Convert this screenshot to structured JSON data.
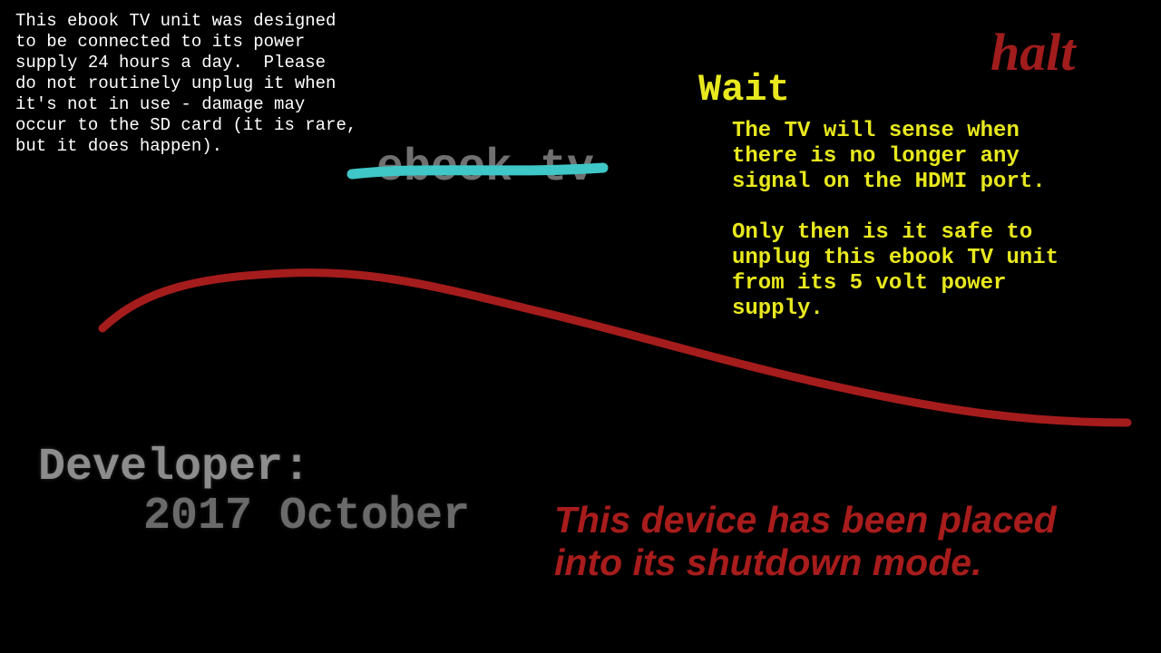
{
  "notice": {
    "text": "This ebook TV unit was designed\nto be connected to its power\nsupply 24 hours a day.  Please\ndo not routinely unplug it when\nit's not in use - damage may\noccur to the SD card (it is rare,\nbut it does happen)."
  },
  "halt": {
    "label": "halt"
  },
  "wait": {
    "title": "Wait",
    "paragraph_1": "The TV will sense when\nthere is no longer any\nsignal on the HDMI port.",
    "paragraph_2": "Only then is it safe to\nunplug this ebook TV unit\nfrom its 5 volt power\nsupply."
  },
  "logo": {
    "text": "ebook tv"
  },
  "developer": {
    "label": "Developer:",
    "date": "2017 October"
  },
  "shutdown": {
    "message": "This device has been placed\ninto its shutdown mode."
  },
  "colors": {
    "background": "#000000",
    "notice_text": "#ffffff",
    "accent_red": "#a81c1c",
    "wait_yellow": "#e8e81e",
    "logo_grey": "#707070",
    "cyan_stroke": "#3fc6c6",
    "red_stroke": "#a51c1c"
  }
}
